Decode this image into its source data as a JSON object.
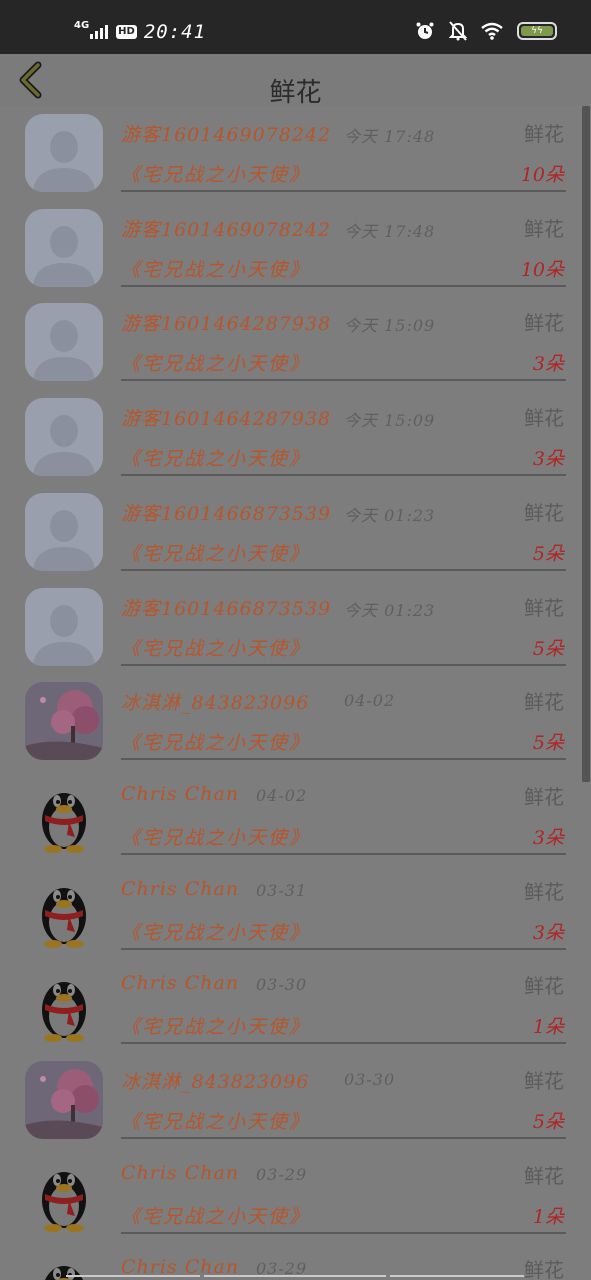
{
  "status_bar": {
    "network": "4G",
    "hd": "HD",
    "time": "20:41",
    "icons": [
      "alarm-icon",
      "bell-off-icon",
      "wifi-icon",
      "battery-icon"
    ]
  },
  "header": {
    "title": "鲜花",
    "back_icon": "chevron-left-icon"
  },
  "records": [
    {
      "avatar": "default",
      "name": "游客1601469078242",
      "time": "今天 17:48",
      "type": "鲜花",
      "book": "《宅兄战之小天使》",
      "count": "10朵"
    },
    {
      "avatar": "default",
      "name": "游客1601469078242",
      "time": "今天 17:48",
      "type": "鲜花",
      "book": "《宅兄战之小天使》",
      "count": "10朵"
    },
    {
      "avatar": "default",
      "name": "游客1601464287938",
      "time": "今天 15:09",
      "type": "鲜花",
      "book": "《宅兄战之小天使》",
      "count": "3朵"
    },
    {
      "avatar": "default",
      "name": "游客1601464287938",
      "time": "今天 15:09",
      "type": "鲜花",
      "book": "《宅兄战之小天使》",
      "count": "3朵"
    },
    {
      "avatar": "default",
      "name": "游客1601466873539",
      "time": "今天 01:23",
      "type": "鲜花",
      "book": "《宅兄战之小天使》",
      "count": "5朵"
    },
    {
      "avatar": "default",
      "name": "游客1601466873539",
      "time": "今天 01:23",
      "type": "鲜花",
      "book": "《宅兄战之小天使》",
      "count": "5朵"
    },
    {
      "avatar": "blossom",
      "name": "冰淇淋_843823096",
      "time": "04-02",
      "type": "鲜花",
      "book": "《宅兄战之小天使》",
      "count": "5朵"
    },
    {
      "avatar": "penguin",
      "name": "Chris Chan",
      "time": "04-02",
      "type": "鲜花",
      "book": "《宅兄战之小天使》",
      "count": "3朵"
    },
    {
      "avatar": "penguin",
      "name": "Chris Chan",
      "time": "03-31",
      "type": "鲜花",
      "book": "《宅兄战之小天使》",
      "count": "3朵"
    },
    {
      "avatar": "penguin",
      "name": "Chris Chan",
      "time": "03-30",
      "type": "鲜花",
      "book": "《宅兄战之小天使》",
      "count": "1朵"
    },
    {
      "avatar": "blossom",
      "name": "冰淇淋_843823096",
      "time": "03-30",
      "type": "鲜花",
      "book": "《宅兄战之小天使》",
      "count": "5朵"
    },
    {
      "avatar": "penguin",
      "name": "Chris Chan",
      "time": "03-29",
      "type": "鲜花",
      "book": "《宅兄战之小天使》",
      "count": "1朵"
    },
    {
      "avatar": "penguin",
      "name": "Chris Chan",
      "time": "03-29",
      "type": "鲜花",
      "book": "",
      "count": ""
    }
  ],
  "colors": {
    "overlay_bg": "#7d7d7d",
    "name_color": "#b7552b",
    "count_color": "#b02525",
    "status_bar": "#262626"
  }
}
